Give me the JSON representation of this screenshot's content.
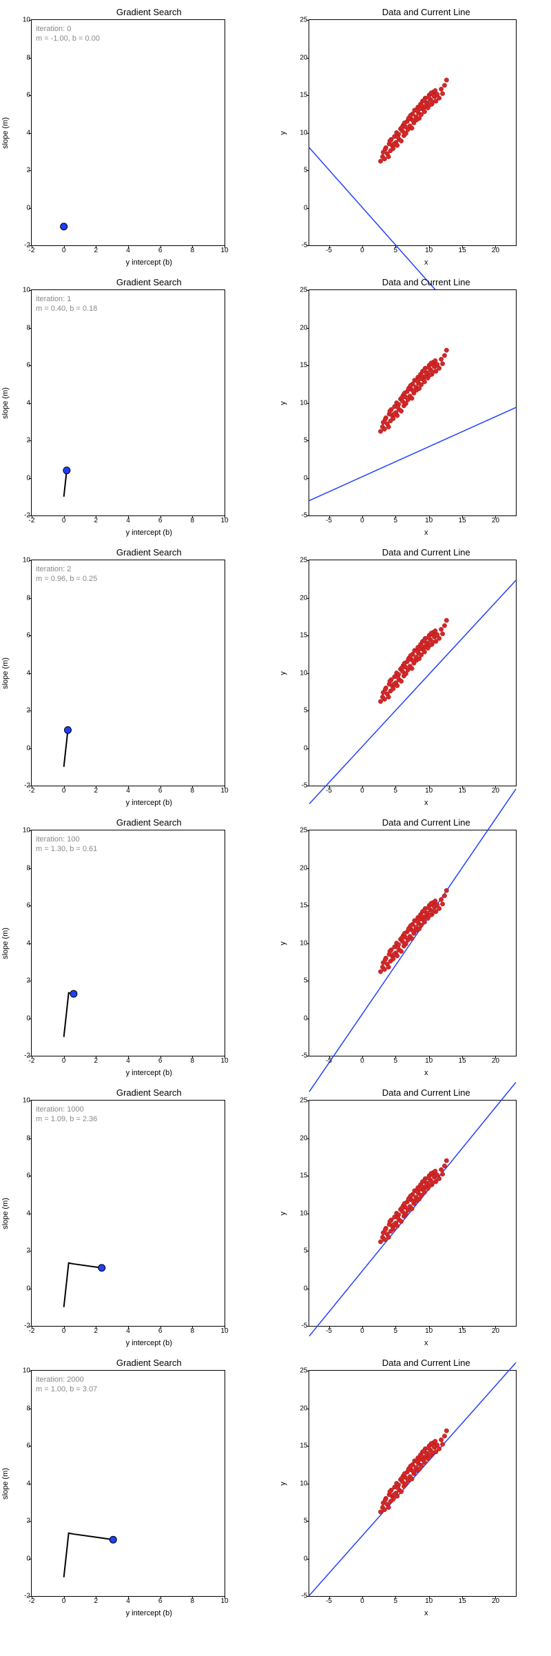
{
  "chart_data": [
    {
      "type": "scatter",
      "title": "Gradient Search",
      "xlabel": "y intercept (b)",
      "ylabel": "slope (m)",
      "xlim": [
        -2,
        10
      ],
      "ylim": [
        -2,
        10
      ],
      "xticks": [
        -2,
        0,
        2,
        4,
        6,
        8,
        10
      ],
      "yticks": [
        -2,
        0,
        2,
        4,
        6,
        8,
        10
      ],
      "annotation": "iteration: 0\nm = -1.00, b = 0.00",
      "path": [
        [
          0,
          -1
        ]
      ],
      "point": [
        0,
        -1
      ]
    },
    {
      "type": "scatter",
      "title": "Data and Current Line",
      "xlabel": "x",
      "ylabel": "y",
      "xlim": [
        -8,
        23
      ],
      "ylim": [
        -5,
        25
      ],
      "xticks": [
        -5,
        0,
        5,
        10,
        15,
        20
      ],
      "yticks": [
        -5,
        0,
        5,
        10,
        15,
        20,
        25
      ],
      "line": {
        "m": -1,
        "b": 0
      }
    },
    {
      "type": "scatter",
      "title": "Gradient Search",
      "xlabel": "y intercept (b)",
      "ylabel": "slope (m)",
      "xlim": [
        -2,
        10
      ],
      "ylim": [
        -2,
        10
      ],
      "xticks": [
        -2,
        0,
        2,
        4,
        6,
        8,
        10
      ],
      "yticks": [
        -2,
        0,
        2,
        4,
        6,
        8,
        10
      ],
      "annotation": "iteration: 1\nm = 0.40, b = 0.18",
      "path": [
        [
          0,
          -1
        ],
        [
          0.18,
          0.4
        ]
      ],
      "point": [
        0.18,
        0.4
      ]
    },
    {
      "type": "scatter",
      "title": "Data and Current Line",
      "xlabel": "x",
      "ylabel": "y",
      "xlim": [
        -8,
        23
      ],
      "ylim": [
        -5,
        25
      ],
      "xticks": [
        -5,
        0,
        5,
        10,
        15,
        20
      ],
      "yticks": [
        -5,
        0,
        5,
        10,
        15,
        20,
        25
      ],
      "line": {
        "m": 0.4,
        "b": 0.18
      }
    },
    {
      "type": "scatter",
      "title": "Gradient Search",
      "xlabel": "y intercept (b)",
      "ylabel": "slope (m)",
      "xlim": [
        -2,
        10
      ],
      "ylim": [
        -2,
        10
      ],
      "xticks": [
        -2,
        0,
        2,
        4,
        6,
        8,
        10
      ],
      "yticks": [
        -2,
        0,
        2,
        4,
        6,
        8,
        10
      ],
      "annotation": "iteration: 2\nm = 0.96, b = 0.25",
      "path": [
        [
          0,
          -1
        ],
        [
          0.18,
          0.4
        ],
        [
          0.25,
          0.96
        ]
      ],
      "point": [
        0.25,
        0.96
      ]
    },
    {
      "type": "scatter",
      "title": "Data and Current Line",
      "xlabel": "x",
      "ylabel": "y",
      "xlim": [
        -8,
        23
      ],
      "ylim": [
        -5,
        25
      ],
      "xticks": [
        -5,
        0,
        5,
        10,
        15,
        20
      ],
      "yticks": [
        -5,
        0,
        5,
        10,
        15,
        20,
        25
      ],
      "line": {
        "m": 0.96,
        "b": 0.25
      }
    },
    {
      "type": "scatter",
      "title": "Gradient Search",
      "xlabel": "y intercept (b)",
      "ylabel": "slope (m)",
      "xlim": [
        -2,
        10
      ],
      "ylim": [
        -2,
        10
      ],
      "xticks": [
        -2,
        0,
        2,
        4,
        6,
        8,
        10
      ],
      "yticks": [
        -2,
        0,
        2,
        4,
        6,
        8,
        10
      ],
      "annotation": "iteration: 100\nm = 1.30, b = 0.61",
      "path": [
        [
          0,
          -1
        ],
        [
          0.18,
          0.4
        ],
        [
          0.25,
          0.96
        ],
        [
          0.3,
          1.35
        ],
        [
          0.61,
          1.3
        ]
      ],
      "point": [
        0.61,
        1.3
      ]
    },
    {
      "type": "scatter",
      "title": "Data and Current Line",
      "xlabel": "x",
      "ylabel": "y",
      "xlim": [
        -8,
        23
      ],
      "ylim": [
        -5,
        25
      ],
      "xticks": [
        -5,
        0,
        5,
        10,
        15,
        20
      ],
      "yticks": [
        -5,
        0,
        5,
        10,
        15,
        20,
        25
      ],
      "line": {
        "m": 1.3,
        "b": 0.61
      }
    },
    {
      "type": "scatter",
      "title": "Gradient Search",
      "xlabel": "y intercept (b)",
      "ylabel": "slope (m)",
      "xlim": [
        -2,
        10
      ],
      "ylim": [
        -2,
        10
      ],
      "xticks": [
        -2,
        0,
        2,
        4,
        6,
        8,
        10
      ],
      "yticks": [
        -2,
        0,
        2,
        4,
        6,
        8,
        10
      ],
      "annotation": "iteration: 1000\nm = 1.09, b = 2.36",
      "path": [
        [
          0,
          -1
        ],
        [
          0.18,
          0.4
        ],
        [
          0.25,
          0.96
        ],
        [
          0.3,
          1.35
        ],
        [
          0.61,
          1.3
        ],
        [
          2.36,
          1.09
        ]
      ],
      "point": [
        2.36,
        1.09
      ]
    },
    {
      "type": "scatter",
      "title": "Data and Current Line",
      "xlabel": "x",
      "ylabel": "y",
      "xlim": [
        -8,
        23
      ],
      "ylim": [
        -5,
        25
      ],
      "xticks": [
        -5,
        0,
        5,
        10,
        15,
        20
      ],
      "yticks": [
        -5,
        0,
        5,
        10,
        15,
        20,
        25
      ],
      "line": {
        "m": 1.09,
        "b": 2.36
      }
    },
    {
      "type": "scatter",
      "title": "Gradient Search",
      "xlabel": "y intercept (b)",
      "ylabel": "slope (m)",
      "xlim": [
        -2,
        10
      ],
      "ylim": [
        -2,
        10
      ],
      "xticks": [
        -2,
        0,
        2,
        4,
        6,
        8,
        10
      ],
      "yticks": [
        -2,
        0,
        2,
        4,
        6,
        8,
        10
      ],
      "annotation": "iteration: 2000\nm = 1.00, b = 3.07",
      "path": [
        [
          0,
          -1
        ],
        [
          0.18,
          0.4
        ],
        [
          0.25,
          0.96
        ],
        [
          0.3,
          1.35
        ],
        [
          0.61,
          1.3
        ],
        [
          2.36,
          1.09
        ],
        [
          3.07,
          1.0
        ]
      ],
      "point": [
        3.07,
        1.0
      ]
    },
    {
      "type": "scatter",
      "title": "Data and Current Line",
      "xlabel": "x",
      "ylabel": "y",
      "xlim": [
        -8,
        23
      ],
      "ylim": [
        -5,
        25
      ],
      "xticks": [
        -5,
        0,
        5,
        10,
        15,
        20
      ],
      "yticks": [
        -5,
        0,
        5,
        10,
        15,
        20,
        25
      ],
      "line": {
        "m": 1.0,
        "b": 3.07
      }
    }
  ],
  "scatter_points": [
    [
      2.7,
      6.2
    ],
    [
      3.0,
      6.8
    ],
    [
      3.1,
      7.4
    ],
    [
      3.3,
      6.5
    ],
    [
      3.5,
      8.0
    ],
    [
      3.7,
      7.2
    ],
    [
      3.9,
      6.8
    ],
    [
      4.0,
      8.5
    ],
    [
      4.2,
      7.6
    ],
    [
      4.3,
      9.1
    ],
    [
      4.5,
      8.2
    ],
    [
      4.6,
      7.9
    ],
    [
      4.8,
      9.5
    ],
    [
      5.0,
      8.7
    ],
    [
      5.1,
      10.0
    ],
    [
      5.2,
      8.3
    ],
    [
      5.4,
      9.8
    ],
    [
      5.5,
      9.1
    ],
    [
      5.7,
      10.5
    ],
    [
      5.8,
      8.9
    ],
    [
      6.0,
      10.2
    ],
    [
      6.1,
      11.0
    ],
    [
      6.2,
      9.6
    ],
    [
      6.4,
      10.8
    ],
    [
      6.5,
      9.9
    ],
    [
      6.7,
      11.5
    ],
    [
      6.8,
      10.4
    ],
    [
      7.0,
      12.0
    ],
    [
      7.1,
      10.9
    ],
    [
      7.3,
      11.8
    ],
    [
      7.4,
      10.6
    ],
    [
      7.5,
      12.5
    ],
    [
      7.7,
      11.3
    ],
    [
      7.8,
      13.0
    ],
    [
      8.0,
      12.1
    ],
    [
      8.1,
      11.7
    ],
    [
      8.3,
      13.4
    ],
    [
      8.4,
      12.6
    ],
    [
      8.5,
      11.9
    ],
    [
      8.7,
      13.8
    ],
    [
      8.8,
      12.4
    ],
    [
      9.0,
      14.2
    ],
    [
      9.1,
      13.1
    ],
    [
      9.3,
      12.8
    ],
    [
      9.4,
      14.6
    ],
    [
      9.5,
      13.5
    ],
    [
      9.7,
      14.0
    ],
    [
      9.8,
      13.3
    ],
    [
      10.0,
      15.0
    ],
    [
      10.2,
      14.4
    ],
    [
      10.4,
      13.8
    ],
    [
      10.6,
      15.4
    ],
    [
      10.8,
      14.8
    ],
    [
      11.0,
      14.2
    ],
    [
      11.2,
      15.1
    ],
    [
      11.5,
      14.6
    ],
    [
      11.8,
      15.8
    ],
    [
      12.0,
      15.2
    ],
    [
      12.3,
      16.3
    ],
    [
      12.6,
      17.0
    ],
    [
      3.4,
      7.8
    ],
    [
      4.1,
      8.9
    ],
    [
      4.7,
      8.5
    ],
    [
      5.3,
      9.4
    ],
    [
      5.9,
      10.7
    ],
    [
      6.3,
      11.3
    ],
    [
      6.9,
      11.9
    ],
    [
      7.2,
      12.3
    ],
    [
      7.6,
      11.6
    ],
    [
      8.2,
      12.9
    ],
    [
      8.6,
      13.2
    ],
    [
      8.9,
      13.6
    ],
    [
      9.2,
      14.3
    ],
    [
      9.6,
      13.9
    ],
    [
      9.9,
      14.7
    ],
    [
      10.1,
      13.7
    ],
    [
      10.3,
      15.3
    ],
    [
      10.5,
      14.1
    ],
    [
      10.7,
      14.9
    ],
    [
      10.9,
      15.6
    ]
  ]
}
